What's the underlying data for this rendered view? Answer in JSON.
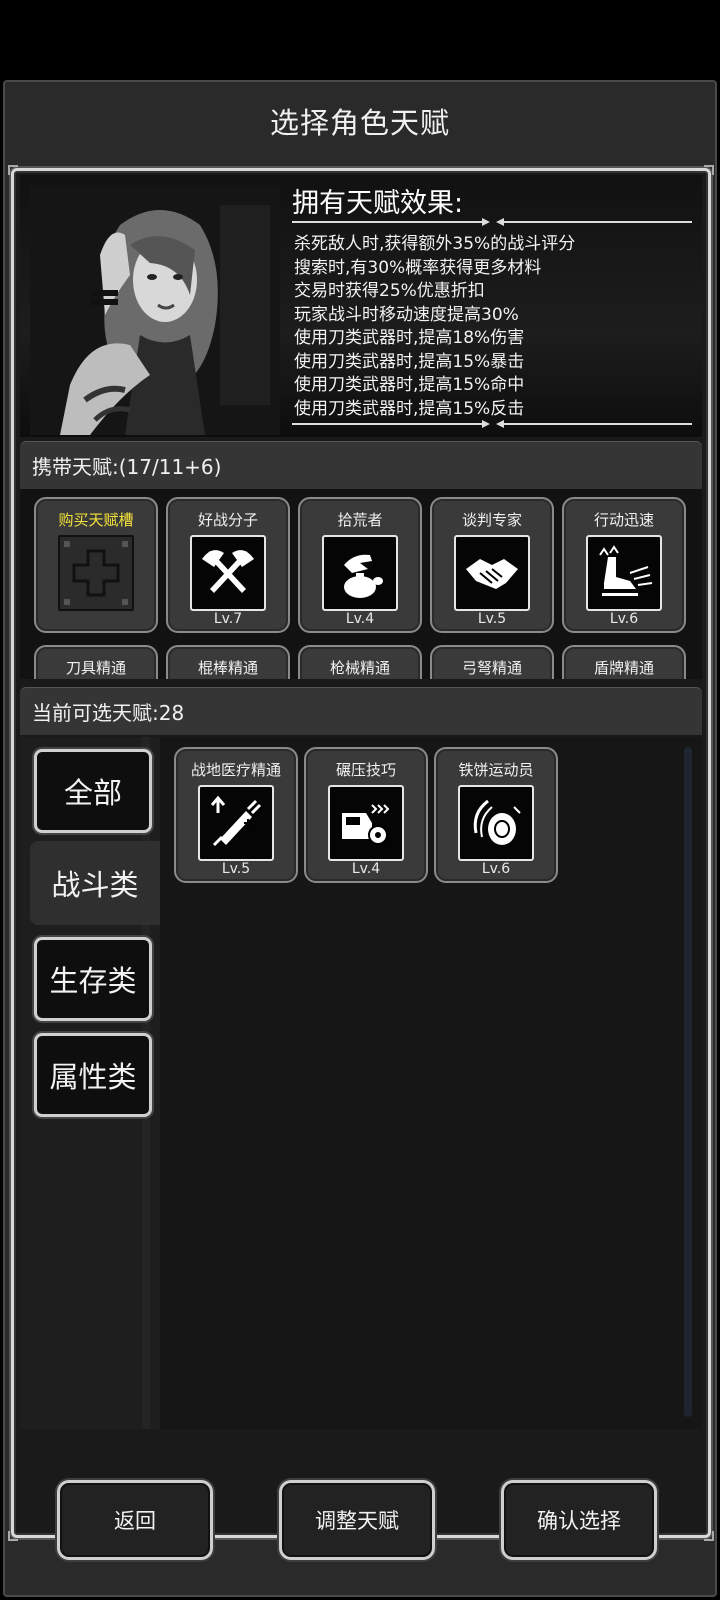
{
  "title": "选择角色天赋",
  "effects": {
    "heading": "拥有天赋效果:",
    "lines": [
      "杀死敌人时,获得额外35%的战斗评分",
      "搜索时,有30%概率获得更多材料",
      "交易时获得25%优惠折扣",
      "玩家战斗时移动速度提高30%",
      "使用刀类武器时,提高18%伤害",
      "使用刀类武器时,提高15%暴击",
      "使用刀类武器时,提高15%命中",
      "使用刀类武器时,提高15%反击"
    ]
  },
  "carried": {
    "header": "携带天赋:(17/11+6)",
    "buy_slot_label": "购买天赋槽",
    "items": [
      {
        "name": "好战分子",
        "level": "Lv.7",
        "icon": "crossed-axes-icon"
      },
      {
        "name": "拾荒者",
        "level": "Lv.4",
        "icon": "hand-bag-icon"
      },
      {
        "name": "谈判专家",
        "level": "Lv.5",
        "icon": "handshake-icon"
      },
      {
        "name": "行动迅速",
        "level": "Lv.6",
        "icon": "running-boot-icon"
      }
    ],
    "second_row": [
      "刀具精通",
      "棍棒精通",
      "枪械精通",
      "弓弩精通",
      "盾牌精通"
    ]
  },
  "available": {
    "header": "当前可选天赋:28",
    "categories": [
      "全部",
      "战斗类",
      "生存类",
      "属性类"
    ],
    "active_category": "战斗类",
    "items": [
      {
        "name": "战地医疗精通",
        "level": "Lv.5",
        "icon": "syringe-icon"
      },
      {
        "name": "碾压技巧",
        "level": "Lv.4",
        "icon": "car-crash-icon"
      },
      {
        "name": "铁饼运动员",
        "level": "Lv.6",
        "icon": "discus-icon"
      }
    ]
  },
  "buttons": {
    "back": "返回",
    "adjust": "调整天赋",
    "confirm": "确认选择"
  }
}
